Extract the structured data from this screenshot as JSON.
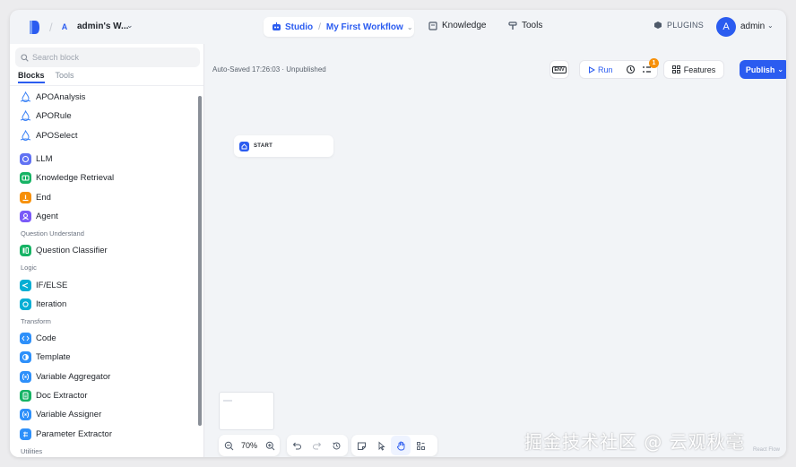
{
  "header": {
    "workspace_badge": "A",
    "workspace_name": "admin's W...",
    "studio_label": "Studio",
    "workflow_name": "My First Workflow",
    "nav_knowledge": "Knowledge",
    "nav_tools": "Tools",
    "plugins_label": "PLUGINS",
    "avatar_letter": "A",
    "user_name": "admin"
  },
  "sidebar": {
    "search_placeholder": "Search block",
    "tabs": [
      "Blocks",
      "Tools"
    ],
    "apo_items": [
      "APOAnalysis",
      "APORule",
      "APOSelect"
    ],
    "core_items": [
      "LLM",
      "Knowledge Retrieval",
      "End",
      "Agent"
    ],
    "section_question": "Question Understand",
    "question_items": [
      "Question Classifier"
    ],
    "section_logic": "Logic",
    "logic_items": [
      "IF/ELSE",
      "Iteration"
    ],
    "section_transform": "Transform",
    "transform_items": [
      "Code",
      "Template",
      "Variable Aggregator",
      "Doc Extractor",
      "Variable Assigner",
      "Parameter Extractor"
    ],
    "section_utilities": "Utilities"
  },
  "canvas": {
    "save_status": "Auto-Saved 17:26:03 · Unpublished",
    "env_label": "ENV",
    "run_label": "Run",
    "checklist_count": "1",
    "features_label": "Features",
    "publish_label": "Publish",
    "start_node_label": "START",
    "zoom_level": "70%",
    "react_flow_credit": "React Flow"
  },
  "watermark": "掘金技术社区 @ 云观秋毫",
  "colors": {
    "accent": "#2b5cf0",
    "badge": "#f79009"
  }
}
